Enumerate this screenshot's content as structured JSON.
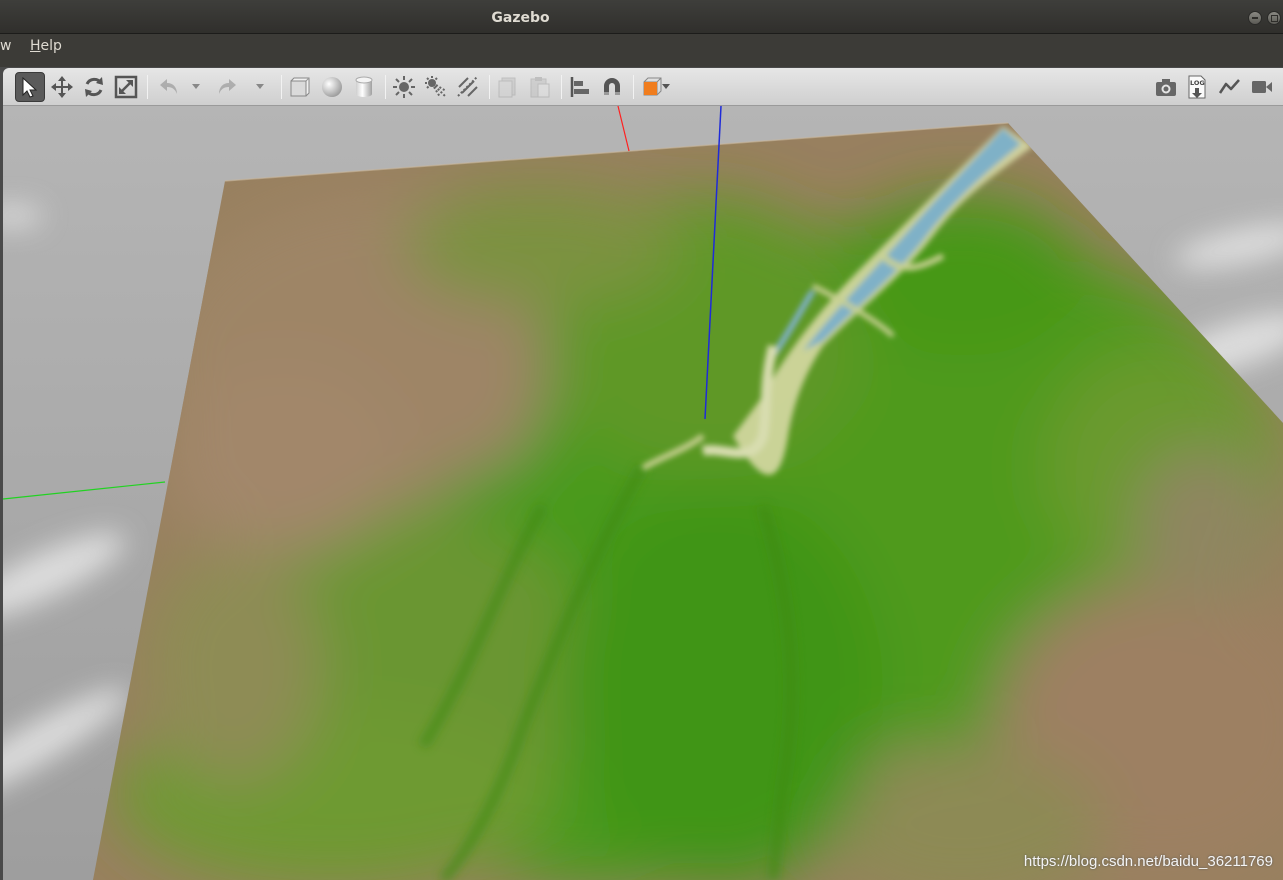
{
  "window": {
    "title": "Gazebo"
  },
  "menu": [
    {
      "label": "w"
    },
    {
      "label": "Help",
      "mnemonic": "H"
    }
  ],
  "toolbar": {
    "left_tools": [
      {
        "name": "select-mode-icon",
        "active": true
      },
      {
        "name": "translate-mode-icon"
      },
      {
        "name": "rotate-mode-icon"
      },
      {
        "name": "scale-mode-icon"
      },
      {
        "name": "undo-icon",
        "disabled": true
      },
      {
        "name": "redo-icon",
        "disabled": true
      },
      {
        "name": "box-shape-icon"
      },
      {
        "name": "sphere-shape-icon"
      },
      {
        "name": "cylinder-shape-icon"
      },
      {
        "name": "point-light-icon"
      },
      {
        "name": "spot-light-icon"
      },
      {
        "name": "directional-light-icon"
      },
      {
        "name": "copy-icon",
        "disabled": true
      },
      {
        "name": "paste-icon",
        "disabled": true
      },
      {
        "name": "align-icon"
      },
      {
        "name": "snap-icon"
      },
      {
        "name": "view-angle-icon"
      }
    ],
    "right_tools": [
      {
        "name": "screenshot-icon"
      },
      {
        "name": "log-icon",
        "text": "LOG"
      },
      {
        "name": "plot-icon"
      },
      {
        "name": "video-record-icon"
      }
    ]
  },
  "colors": {
    "terrain_green": "#4f9a1c",
    "terrain_brown": "#9c8467",
    "water_blue": "#7fb1c7",
    "sky_gray": "#a9a9a9",
    "axis_x": "#ff2020",
    "axis_y": "#21d321",
    "axis_z": "#1f2bd8",
    "view_angle_accent": "#f07d1e"
  },
  "watermark": "https://blog.csdn.net/baidu_36211769"
}
